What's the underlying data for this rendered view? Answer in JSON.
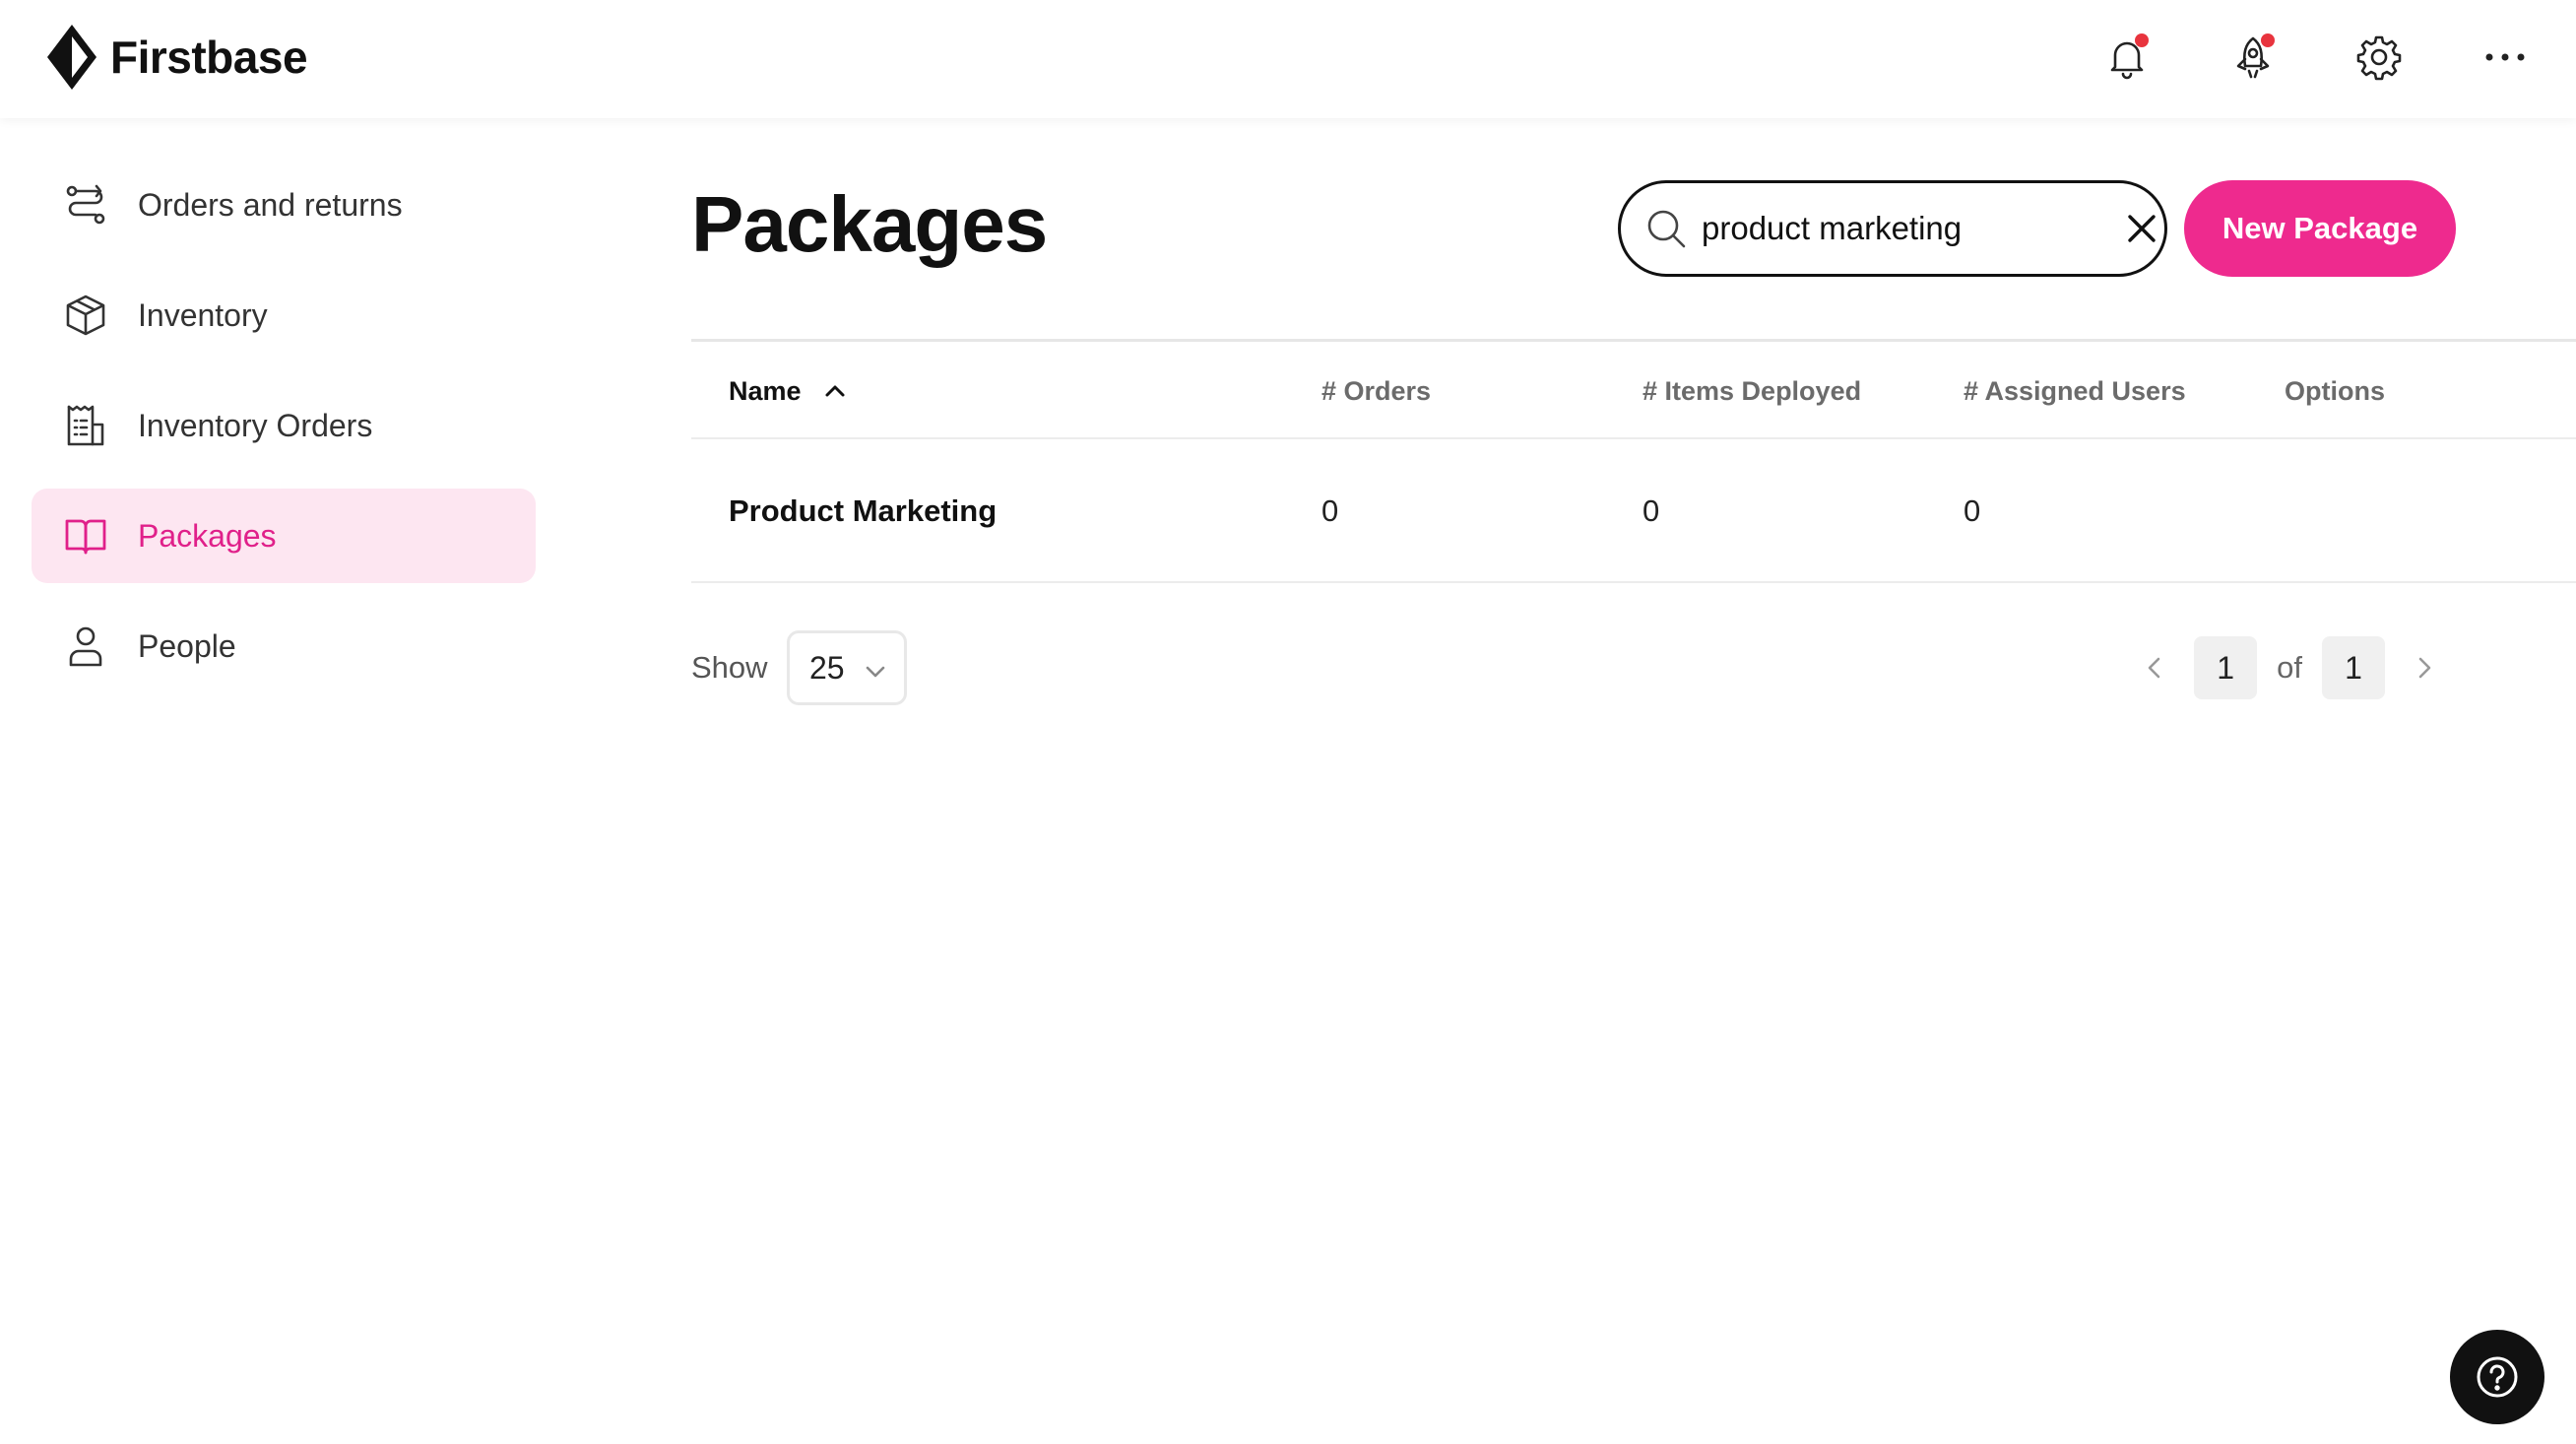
{
  "brand": {
    "name": "Firstbase"
  },
  "topbar": {
    "icons": [
      "bell-icon",
      "rocket-icon",
      "gear-icon",
      "more-icon"
    ],
    "notification_color": "#e8343e"
  },
  "sidebar": {
    "items": [
      {
        "label": "Orders and returns",
        "icon": "route-icon",
        "active": false
      },
      {
        "label": "Inventory",
        "icon": "box-icon",
        "active": false
      },
      {
        "label": "Inventory Orders",
        "icon": "receipt-icon",
        "active": false
      },
      {
        "label": "Packages",
        "icon": "book-open-icon",
        "active": true
      },
      {
        "label": "People",
        "icon": "person-icon",
        "active": false
      }
    ]
  },
  "main": {
    "title": "Packages",
    "search": {
      "value": "product marketing",
      "placeholder": ""
    },
    "new_button": "New Package",
    "accent_color": "#ee2a8e",
    "table": {
      "columns": [
        "Name",
        "# Orders",
        "# Items Deployed",
        "# Assigned Users",
        "Options"
      ],
      "sort": {
        "column": "Name",
        "direction": "ascending"
      },
      "rows": [
        {
          "name": "Product Marketing",
          "orders": "0",
          "items_deployed": "0",
          "assigned_users": "0",
          "options": ""
        }
      ]
    },
    "pagination": {
      "show_label": "Show",
      "page_size": "25",
      "current_page": "1",
      "of_label": "of",
      "total_pages": "1"
    }
  },
  "help": {
    "icon": "help-icon"
  }
}
